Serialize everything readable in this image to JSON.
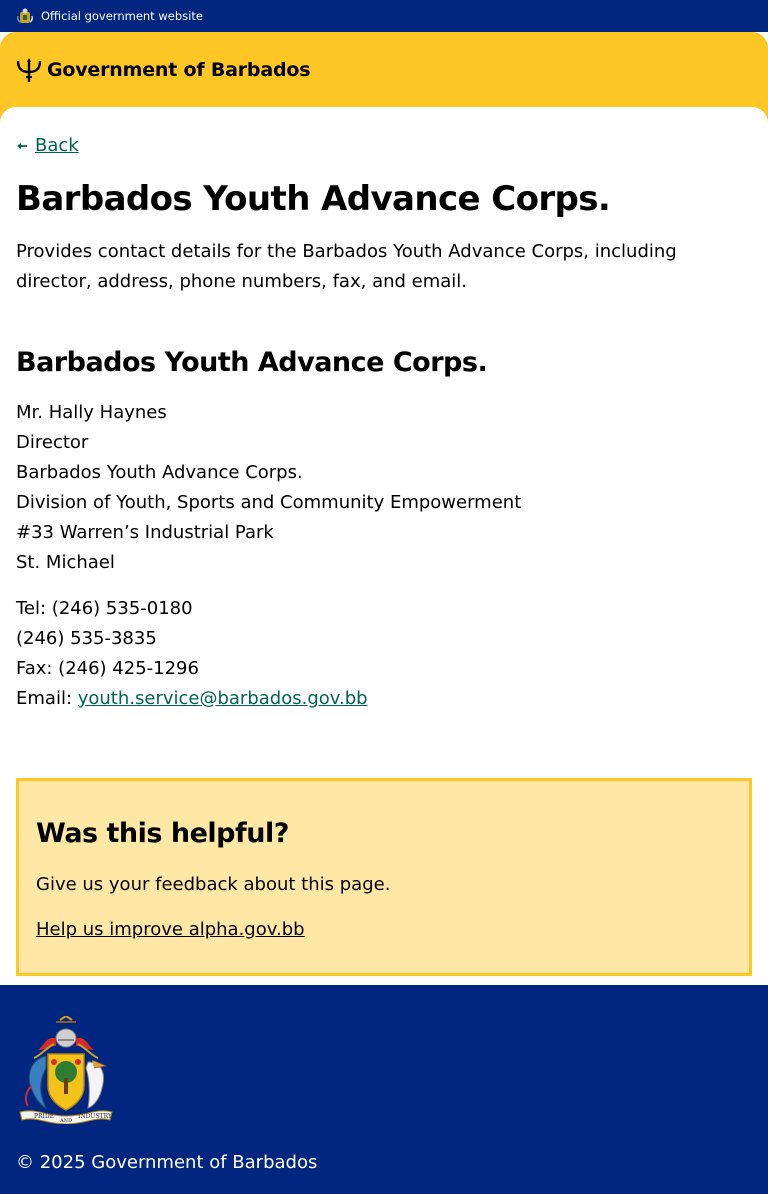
{
  "gov_strip": {
    "label": "Official government website",
    "bg_color": "#00267f"
  },
  "header": {
    "site_name": "Government of Barbados",
    "logo_icon": "trident-icon",
    "bg_color": "#ffc726"
  },
  "nav": {
    "back_label": "Back",
    "back_icon": "arrow-left-icon"
  },
  "page": {
    "title": "Barbados Youth Advance Corps.",
    "summary": "Provides contact details for the Barbados Youth Advance Corps, including director, address, phone numbers, fax, and email.",
    "section_title": "Barbados Youth Advance Corps.",
    "address_lines": [
      "Mr. Hally Haynes",
      "Director",
      "Barbados Youth Advance Corps.",
      "Division of Youth, Sports and Community Empowerment",
      "#33 Warren’s Industrial Park",
      "St. Michael"
    ],
    "contact": {
      "tel_line": "Tel: (246) 535-0180",
      "tel2_line": "(246) 535-3835",
      "fax_line": "Fax: (246) 425-1296",
      "email_prefix": "Email: ",
      "email": "youth.service@barbados.gov.bb"
    },
    "link_color": "#00654a"
  },
  "feedback": {
    "title": "Was this helpful?",
    "text": "Give us your feedback about this page.",
    "link_label": "Help us improve alpha.gov.bb",
    "bg_color": "#ffe8a5",
    "border_color": "#ffc726"
  },
  "footer": {
    "copyright": "© 2025 Government of Barbados",
    "coat_of_arms_motto_1": "PRIDE",
    "coat_of_arms_motto_2": "AND",
    "coat_of_arms_motto_3": "INDUSTRY",
    "crest_icon": "coat-of-arms-icon"
  }
}
